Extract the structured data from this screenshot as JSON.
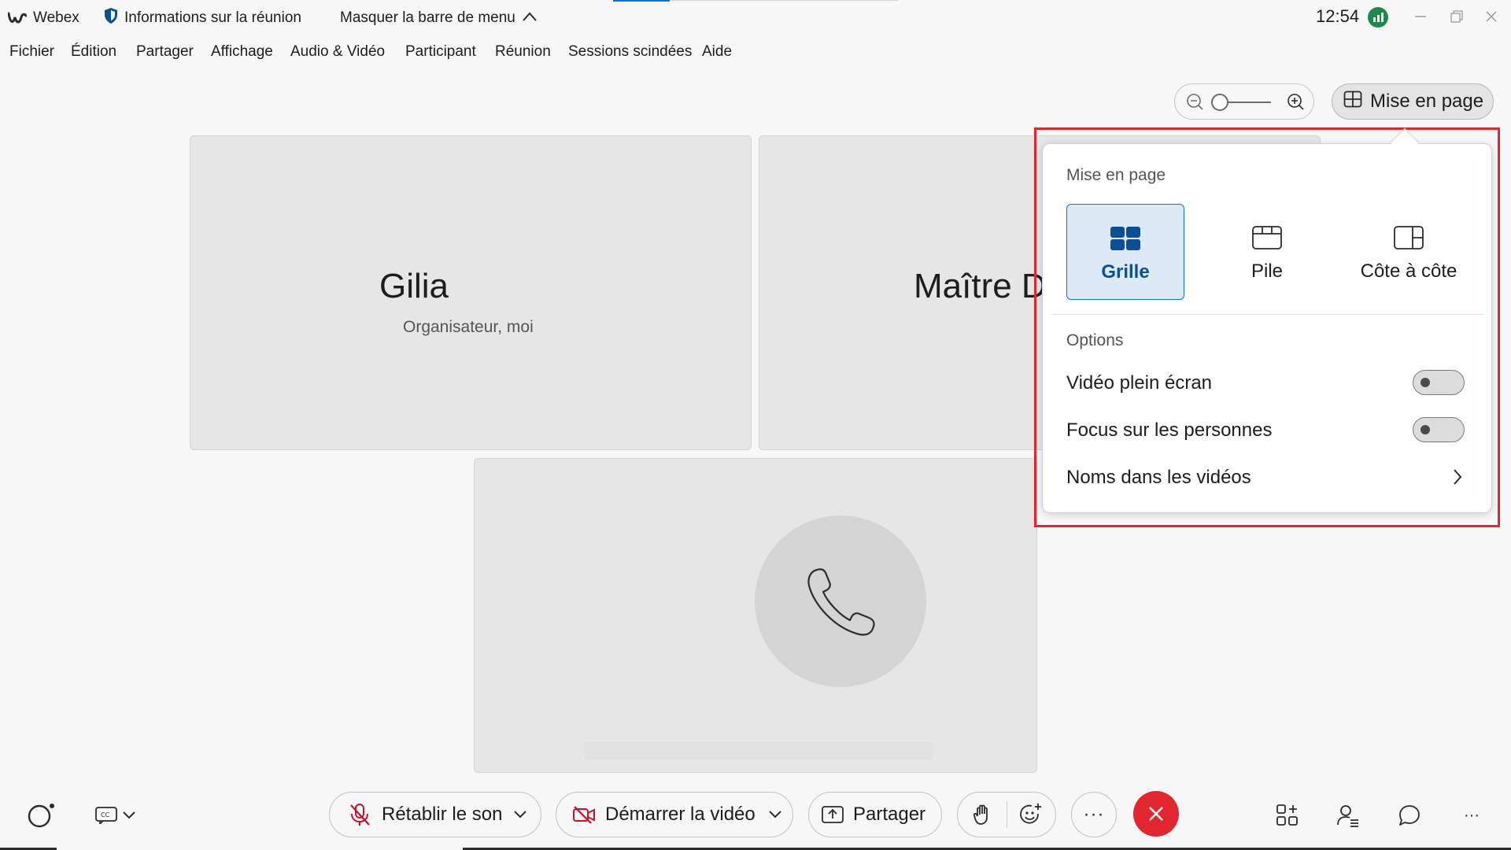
{
  "titlebar": {
    "app_name": "Webex",
    "meeting_info": "Informations sur la réunion",
    "hide_menu": "Masquer la barre de menu",
    "clock": "12:54"
  },
  "menu": {
    "items": [
      "Fichier",
      "Édition",
      "Partager",
      "Affichage",
      "Audio & Vidéo",
      "Participant",
      "Réunion",
      "Sessions scindées",
      "Aide"
    ]
  },
  "toolbar": {
    "layout_button": "Mise en page"
  },
  "tiles": [
    {
      "name": "Gilia",
      "role": "Organisateur, moi"
    },
    {
      "name": "Maître D"
    }
  ],
  "popup": {
    "title": "Mise en page",
    "layouts": [
      {
        "label": "Grille",
        "icon": "grid-icon",
        "selected": true
      },
      {
        "label": "Pile",
        "icon": "stack-icon",
        "selected": false
      },
      {
        "label": "Côte à côte",
        "icon": "side-by-side-icon",
        "selected": false
      }
    ],
    "options_title": "Options",
    "options": [
      {
        "label": "Vidéo plein écran",
        "enabled": false
      },
      {
        "label": "Focus sur les personnes",
        "enabled": false
      }
    ],
    "names_in_videos": "Noms dans les vidéos"
  },
  "bottombar": {
    "unmute": "Rétablir le son",
    "start_video": "Démarrer la vidéo",
    "share": "Partager",
    "more": "···",
    "overflow": "···"
  },
  "colors": {
    "accent": "#1170cf",
    "end_call": "#e1262f",
    "highlight": "#e8222f",
    "mute_red": "#c8102e"
  }
}
